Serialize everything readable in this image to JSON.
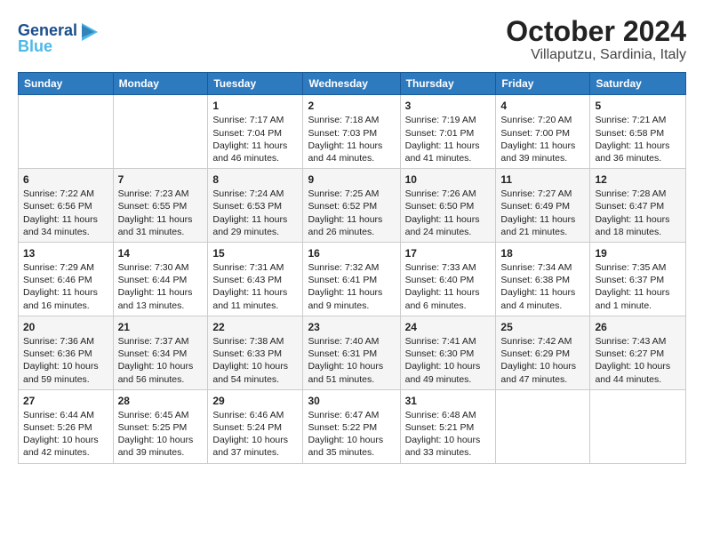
{
  "header": {
    "logo_line1": "General",
    "logo_line2": "Blue",
    "title": "October 2024",
    "subtitle": "Villaputzu, Sardinia, Italy"
  },
  "columns": [
    "Sunday",
    "Monday",
    "Tuesday",
    "Wednesday",
    "Thursday",
    "Friday",
    "Saturday"
  ],
  "weeks": [
    [
      {
        "day": "",
        "info": ""
      },
      {
        "day": "",
        "info": ""
      },
      {
        "day": "1",
        "info": "Sunrise: 7:17 AM\nSunset: 7:04 PM\nDaylight: 11 hours and 46 minutes."
      },
      {
        "day": "2",
        "info": "Sunrise: 7:18 AM\nSunset: 7:03 PM\nDaylight: 11 hours and 44 minutes."
      },
      {
        "day": "3",
        "info": "Sunrise: 7:19 AM\nSunset: 7:01 PM\nDaylight: 11 hours and 41 minutes."
      },
      {
        "day": "4",
        "info": "Sunrise: 7:20 AM\nSunset: 7:00 PM\nDaylight: 11 hours and 39 minutes."
      },
      {
        "day": "5",
        "info": "Sunrise: 7:21 AM\nSunset: 6:58 PM\nDaylight: 11 hours and 36 minutes."
      }
    ],
    [
      {
        "day": "6",
        "info": "Sunrise: 7:22 AM\nSunset: 6:56 PM\nDaylight: 11 hours and 34 minutes."
      },
      {
        "day": "7",
        "info": "Sunrise: 7:23 AM\nSunset: 6:55 PM\nDaylight: 11 hours and 31 minutes."
      },
      {
        "day": "8",
        "info": "Sunrise: 7:24 AM\nSunset: 6:53 PM\nDaylight: 11 hours and 29 minutes."
      },
      {
        "day": "9",
        "info": "Sunrise: 7:25 AM\nSunset: 6:52 PM\nDaylight: 11 hours and 26 minutes."
      },
      {
        "day": "10",
        "info": "Sunrise: 7:26 AM\nSunset: 6:50 PM\nDaylight: 11 hours and 24 minutes."
      },
      {
        "day": "11",
        "info": "Sunrise: 7:27 AM\nSunset: 6:49 PM\nDaylight: 11 hours and 21 minutes."
      },
      {
        "day": "12",
        "info": "Sunrise: 7:28 AM\nSunset: 6:47 PM\nDaylight: 11 hours and 18 minutes."
      }
    ],
    [
      {
        "day": "13",
        "info": "Sunrise: 7:29 AM\nSunset: 6:46 PM\nDaylight: 11 hours and 16 minutes."
      },
      {
        "day": "14",
        "info": "Sunrise: 7:30 AM\nSunset: 6:44 PM\nDaylight: 11 hours and 13 minutes."
      },
      {
        "day": "15",
        "info": "Sunrise: 7:31 AM\nSunset: 6:43 PM\nDaylight: 11 hours and 11 minutes."
      },
      {
        "day": "16",
        "info": "Sunrise: 7:32 AM\nSunset: 6:41 PM\nDaylight: 11 hours and 9 minutes."
      },
      {
        "day": "17",
        "info": "Sunrise: 7:33 AM\nSunset: 6:40 PM\nDaylight: 11 hours and 6 minutes."
      },
      {
        "day": "18",
        "info": "Sunrise: 7:34 AM\nSunset: 6:38 PM\nDaylight: 11 hours and 4 minutes."
      },
      {
        "day": "19",
        "info": "Sunrise: 7:35 AM\nSunset: 6:37 PM\nDaylight: 11 hours and 1 minute."
      }
    ],
    [
      {
        "day": "20",
        "info": "Sunrise: 7:36 AM\nSunset: 6:36 PM\nDaylight: 10 hours and 59 minutes."
      },
      {
        "day": "21",
        "info": "Sunrise: 7:37 AM\nSunset: 6:34 PM\nDaylight: 10 hours and 56 minutes."
      },
      {
        "day": "22",
        "info": "Sunrise: 7:38 AM\nSunset: 6:33 PM\nDaylight: 10 hours and 54 minutes."
      },
      {
        "day": "23",
        "info": "Sunrise: 7:40 AM\nSunset: 6:31 PM\nDaylight: 10 hours and 51 minutes."
      },
      {
        "day": "24",
        "info": "Sunrise: 7:41 AM\nSunset: 6:30 PM\nDaylight: 10 hours and 49 minutes."
      },
      {
        "day": "25",
        "info": "Sunrise: 7:42 AM\nSunset: 6:29 PM\nDaylight: 10 hours and 47 minutes."
      },
      {
        "day": "26",
        "info": "Sunrise: 7:43 AM\nSunset: 6:27 PM\nDaylight: 10 hours and 44 minutes."
      }
    ],
    [
      {
        "day": "27",
        "info": "Sunrise: 6:44 AM\nSunset: 5:26 PM\nDaylight: 10 hours and 42 minutes."
      },
      {
        "day": "28",
        "info": "Sunrise: 6:45 AM\nSunset: 5:25 PM\nDaylight: 10 hours and 39 minutes."
      },
      {
        "day": "29",
        "info": "Sunrise: 6:46 AM\nSunset: 5:24 PM\nDaylight: 10 hours and 37 minutes."
      },
      {
        "day": "30",
        "info": "Sunrise: 6:47 AM\nSunset: 5:22 PM\nDaylight: 10 hours and 35 minutes."
      },
      {
        "day": "31",
        "info": "Sunrise: 6:48 AM\nSunset: 5:21 PM\nDaylight: 10 hours and 33 minutes."
      },
      {
        "day": "",
        "info": ""
      },
      {
        "day": "",
        "info": ""
      }
    ]
  ]
}
